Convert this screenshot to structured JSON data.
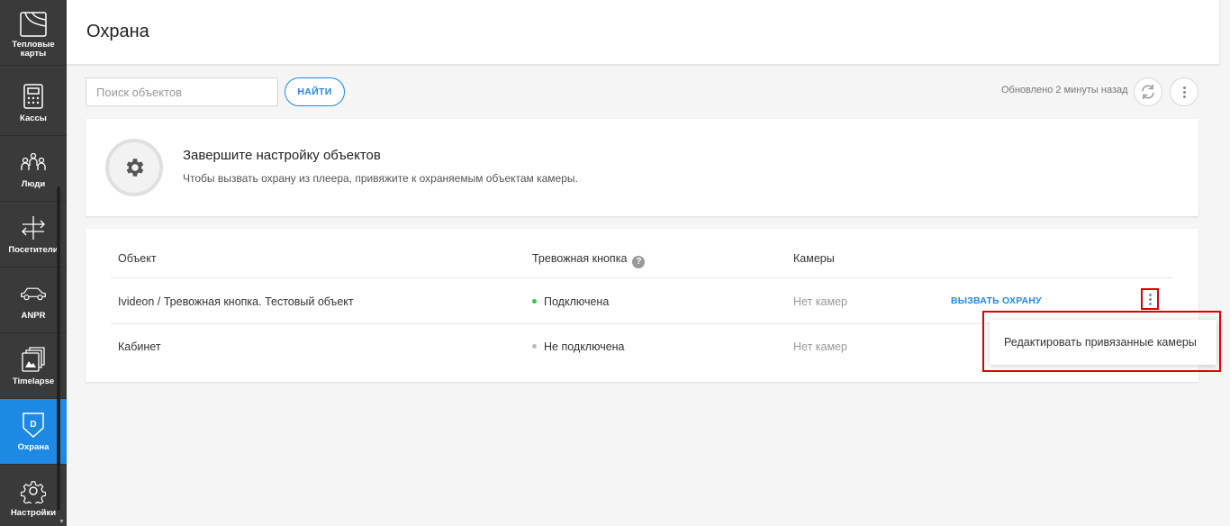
{
  "sidebar": {
    "items": [
      {
        "label": "Тепловые\nкарты",
        "icon": "heatmap-icon"
      },
      {
        "label": "Кассы",
        "icon": "cash-register-icon"
      },
      {
        "label": "Люди",
        "icon": "people-icon"
      },
      {
        "label": "Посетители",
        "icon": "visitors-icon"
      },
      {
        "label": "ANPR",
        "icon": "car-icon"
      },
      {
        "label": "Timelapse",
        "icon": "timelapse-icon"
      },
      {
        "label": "Охрана",
        "icon": "shield-icon",
        "badge": "D",
        "active": true
      },
      {
        "label": "Настройки",
        "icon": "gear-icon"
      }
    ]
  },
  "header": {
    "title": "Охрана"
  },
  "toolbar": {
    "search_placeholder": "Поиск объектов",
    "find_label": "НАЙТИ",
    "updated_text": "Обновлено 2 минуты назад"
  },
  "setup": {
    "title": "Завершите настройку объектов",
    "description": "Чтобы вызвать охрану из плеера, привяжите к охраняемым объектам камеры."
  },
  "table": {
    "headers": {
      "object": "Объект",
      "alarm": "Тревожная кнопка",
      "help": "?",
      "cameras": "Камеры"
    },
    "rows": [
      {
        "object": "Ivideon / Тревожная кнопка. Тестовый объект",
        "status": "Подключена",
        "status_color": "#2ecc40",
        "cameras": "Нет камер",
        "action": "ВЫЗВАТЬ ОХРАНУ"
      },
      {
        "object": "Кабинет",
        "status": "Не подключена",
        "status_color": "#bbbbbb",
        "cameras": "Нет камер"
      }
    ]
  },
  "dropdown": {
    "item": "Редактировать привязанные камеры"
  },
  "colors": {
    "accent": "#1e88e5",
    "sidebar_bg": "#3a3a3a",
    "highlight": "#e00000"
  }
}
